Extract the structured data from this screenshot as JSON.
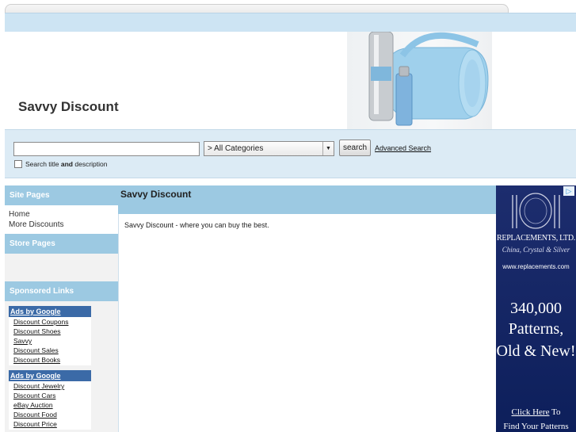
{
  "header": {
    "title": "Savvy Discount"
  },
  "search": {
    "value": "",
    "placeholder": "",
    "category": "> All Categories",
    "button": "search",
    "advanced": "Advanced Search",
    "desc_prefix": "Search title ",
    "desc_bold": "and",
    "desc_suffix": " description"
  },
  "sidebar": {
    "site_pages_heading": "Site Pages",
    "site_links": [
      "Home",
      "More Discounts"
    ],
    "store_pages_heading": "Store Pages",
    "sponsored_heading": "Sponsored Links",
    "ad_groups": [
      {
        "head": "Ads by Google",
        "links": [
          "Discount Coupons",
          "Discount Shoes",
          "Savvy",
          "Discount Sales",
          "Discount Books"
        ]
      },
      {
        "head": "Ads by Google",
        "links": [
          "Discount Jewelry",
          "Discount Cars",
          "eBay Auction",
          "Discount Food",
          "Discount Price"
        ]
      }
    ]
  },
  "main": {
    "heading": "Savvy Discount",
    "text": "Savvy Discount - where you can buy the best."
  },
  "right_ad": {
    "brand": "REPLACEMENTS, LTD.",
    "sub": "China, Crystal & Silver",
    "url": "www.replacements.com",
    "big1": "340,000",
    "big2": "Patterns,",
    "big3": "Old & New!",
    "cta_link": "Click Here",
    "cta_rest": " To",
    "cta_line2": "Find Your Patterns"
  }
}
